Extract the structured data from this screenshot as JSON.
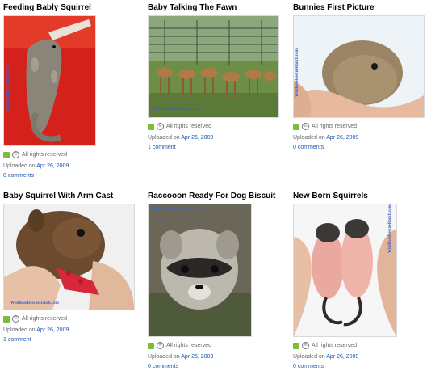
{
  "photos": [
    {
      "title": "Feeding Bably Squirrel",
      "rights": "All rights reserved",
      "uploaded_prefix": "Uploaded on",
      "date": "Apr 26, 2009",
      "comments": "0 comments",
      "watermark": "WildRoseRescueRanch.com"
    },
    {
      "title": "Baby Talking The Fawn",
      "rights": "All rights reserved",
      "uploaded_prefix": "Uploaded on",
      "date": "Apr 26, 2009",
      "comments": "1 comment",
      "watermark": "WildRoseRescueRanch.com"
    },
    {
      "title": "Bunnies First Picture",
      "rights": "All rights reserved",
      "uploaded_prefix": "Uploaded on",
      "date": "Apr 26, 2009",
      "comments": "0 comments",
      "watermark": "WildRoseRescueRanch.com"
    },
    {
      "title": "Baby Squirrel With Arm Cast",
      "rights": "All rights reserved",
      "uploaded_prefix": "Uploaded on",
      "date": "Apr 26, 2009",
      "comments": "1 comment",
      "watermark": "WildRoseRescueRanch.com"
    },
    {
      "title": "Raccooon Ready For Dog Biscuit",
      "rights": "All rights reserved",
      "uploaded_prefix": "Uploaded on",
      "date": "Apr 26, 2009",
      "comments": "0 comments",
      "watermark": "WildRoseRescueRanch.com"
    },
    {
      "title": "New Born Squirrels",
      "rights": "All rights reserved",
      "uploaded_prefix": "Uploaded on",
      "date": "Apr 26, 2009",
      "comments": "0 comments",
      "watermark": "WildRoseRescueRanch.com"
    }
  ],
  "icons": {
    "license_icon": "cc-license-icon",
    "copyright_icon": "copyright-icon"
  }
}
